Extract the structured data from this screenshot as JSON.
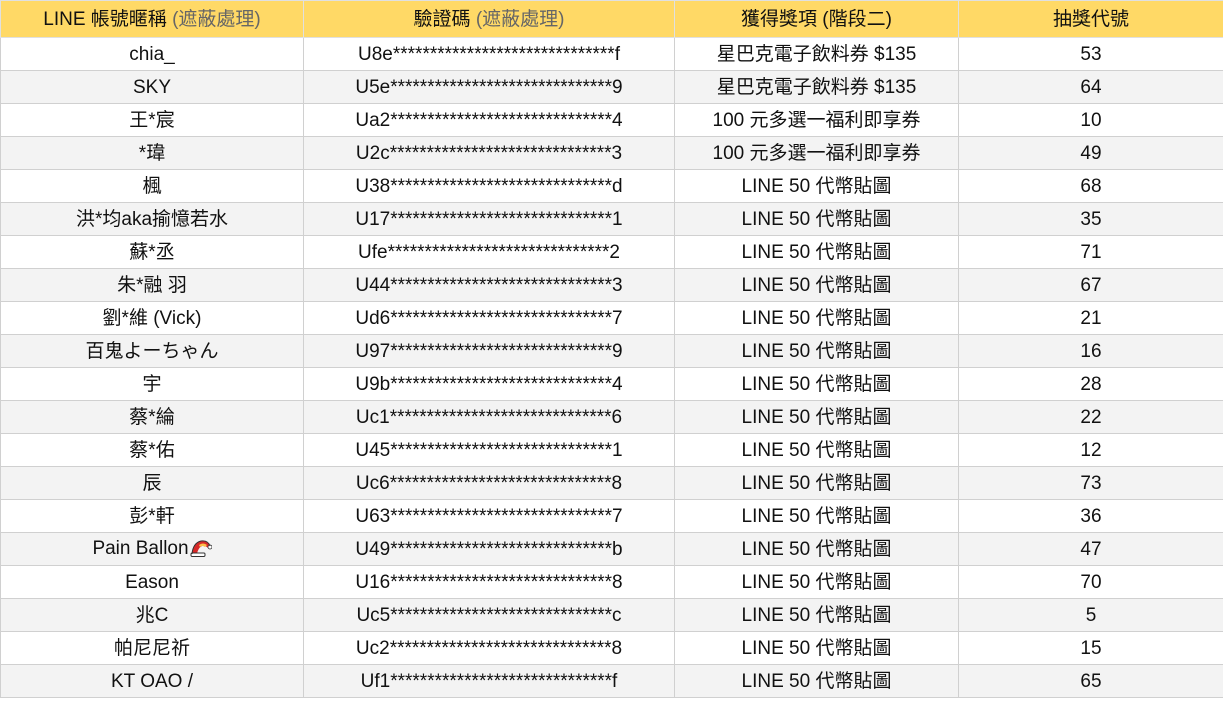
{
  "headers": {
    "nickname": "LINE 帳號暱稱",
    "nickname_note": "(遮蔽處理)",
    "code": "驗證碼",
    "code_note": "(遮蔽處理)",
    "prize": "獲得獎項 (階段二)",
    "lottery": "抽獎代號"
  },
  "rows": [
    {
      "nickname": "chia_",
      "code": "U8e******************************f",
      "prize": "星巴克電子飲料券 $135",
      "lottery": "53"
    },
    {
      "nickname": "SKY",
      "code": "U5e******************************9",
      "prize": "星巴克電子飲料券 $135",
      "lottery": "64"
    },
    {
      "nickname": "王*宸",
      "code": "Ua2******************************4",
      "prize": "100 元多選一福利即享券",
      "lottery": "10"
    },
    {
      "nickname": "*瑋",
      "code": "U2c******************************3",
      "prize": "100 元多選一福利即享券",
      "lottery": "49"
    },
    {
      "nickname": "楓",
      "code": "U38******************************d",
      "prize": "LINE 50 代幣貼圖",
      "lottery": "68"
    },
    {
      "nickname": "洪*均aka揄憶若水",
      "code": "U17******************************1",
      "prize": "LINE 50 代幣貼圖",
      "lottery": "35"
    },
    {
      "nickname": "蘇*丞",
      "code": "Ufe******************************2",
      "prize": "LINE 50 代幣貼圖",
      "lottery": "71"
    },
    {
      "nickname": "朱*融 羽",
      "code": "U44******************************3",
      "prize": "LINE 50 代幣貼圖",
      "lottery": "67"
    },
    {
      "nickname": "劉*維 (Vick)",
      "code": "Ud6******************************7",
      "prize": "LINE 50 代幣貼圖",
      "lottery": "21"
    },
    {
      "nickname": "百鬼よーちゃん",
      "code": "U97******************************9",
      "prize": "LINE 50 代幣貼圖",
      "lottery": "16"
    },
    {
      "nickname": "宇",
      "code": "U9b******************************4",
      "prize": "LINE 50 代幣貼圖",
      "lottery": "28"
    },
    {
      "nickname": "蔡*綸",
      "code": "Uc1******************************6",
      "prize": "LINE 50 代幣貼圖",
      "lottery": "22"
    },
    {
      "nickname": "蔡*佑",
      "code": "U45******************************1",
      "prize": "LINE 50 代幣貼圖",
      "lottery": "12"
    },
    {
      "nickname": "辰",
      "code": "Uc6******************************8",
      "prize": "LINE 50 代幣貼圖",
      "lottery": "73"
    },
    {
      "nickname": "彭*軒",
      "code": "U63******************************7",
      "prize": "LINE 50 代幣貼圖",
      "lottery": "36"
    },
    {
      "nickname": "Pain Ballon",
      "code": "U49******************************b",
      "prize": "LINE 50 代幣貼圖",
      "lottery": "47",
      "icon": "santa-hat-icon"
    },
    {
      "nickname": "Eason",
      "code": "U16******************************8",
      "prize": "LINE 50 代幣貼圖",
      "lottery": "70"
    },
    {
      "nickname": "兆C",
      "code": "Uc5******************************c",
      "prize": "LINE 50 代幣貼圖",
      "lottery": "5"
    },
    {
      "nickname": "帕尼尼祈",
      "code": "Uc2******************************8",
      "prize": "LINE 50 代幣貼圖",
      "lottery": "15"
    },
    {
      "nickname": "KT OAO /",
      "code": "Uf1******************************f",
      "prize": "LINE 50 代幣貼圖",
      "lottery": "65"
    }
  ],
  "colors": {
    "header_bg": "#ffd966",
    "stripe_bg": "#f3f3f3",
    "grid": "#d0d0d0"
  }
}
